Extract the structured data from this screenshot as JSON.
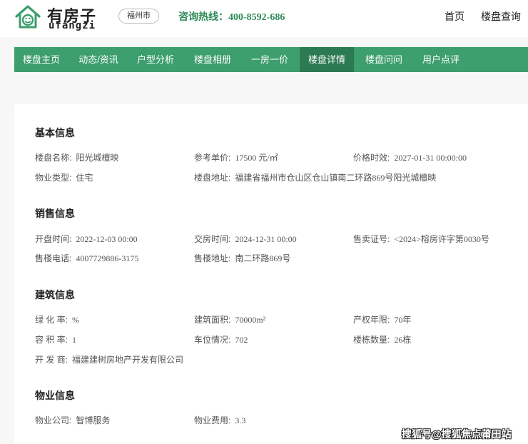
{
  "brand": {
    "name_cn": "有房子",
    "name_en": "ufangzi"
  },
  "header": {
    "city": "福州市",
    "hotline_label": "咨询热线：",
    "hotline_number": "400-8592-686",
    "links": [
      "首页",
      "楼盘查询"
    ]
  },
  "nav": {
    "items": [
      "楼盘主页",
      "动态/资讯",
      "户型分析",
      "楼盘相册",
      "一房一价",
      "楼盘详情",
      "楼盘问问",
      "用户点评"
    ],
    "active": "楼盘详情"
  },
  "sections": [
    {
      "title": "基本信息",
      "fields": [
        {
          "label": "楼盘名称:",
          "value": "阳光城檀映"
        },
        {
          "label": "参考单价:",
          "value": "17500 元/㎡"
        },
        {
          "label": "价格时效:",
          "value": "2027-01-31 00:00:00"
        },
        {
          "label": "物业类型:",
          "value": "住宅"
        },
        {
          "label": "楼盘地址:",
          "value": "福建省福州市仓山区仓山镇南二环路869号阳光城檀映"
        }
      ]
    },
    {
      "title": "销售信息",
      "fields": [
        {
          "label": "开盘时间:",
          "value": "2022-12-03 00:00"
        },
        {
          "label": "交房时间:",
          "value": "2024-12-31 00:00"
        },
        {
          "label": "售卖证号:",
          "value": "<2024>榕房许字第0030号"
        },
        {
          "label": "售楼电话:",
          "value": "4007729886-3175"
        },
        {
          "label": "售楼地址:",
          "value": "南二环路869号"
        }
      ]
    },
    {
      "title": "建筑信息",
      "fields": [
        {
          "label": "绿 化 率:",
          "value": "%"
        },
        {
          "label": "建筑面积:",
          "value": "70000m²"
        },
        {
          "label": "产权年限:",
          "value": "70年"
        },
        {
          "label": "容 积 率:",
          "value": "1"
        },
        {
          "label": "车位情况:",
          "value": "702"
        },
        {
          "label": "楼栋数量:",
          "value": "26栋"
        },
        {
          "label": "开 发 商:",
          "value": "福建建树房地产开发有限公司"
        }
      ]
    },
    {
      "title": "物业信息",
      "fields": [
        {
          "label": "物业公司:",
          "value": "智博服务"
        },
        {
          "label": "物业费用:",
          "value": "3.3"
        }
      ]
    }
  ],
  "watermark": "搜狐号@搜狐焦点莆田站",
  "colors": {
    "brand_green": "#3d9e6e",
    "active_green": "#2c7a52",
    "hotline_green": "#2e8b57"
  }
}
